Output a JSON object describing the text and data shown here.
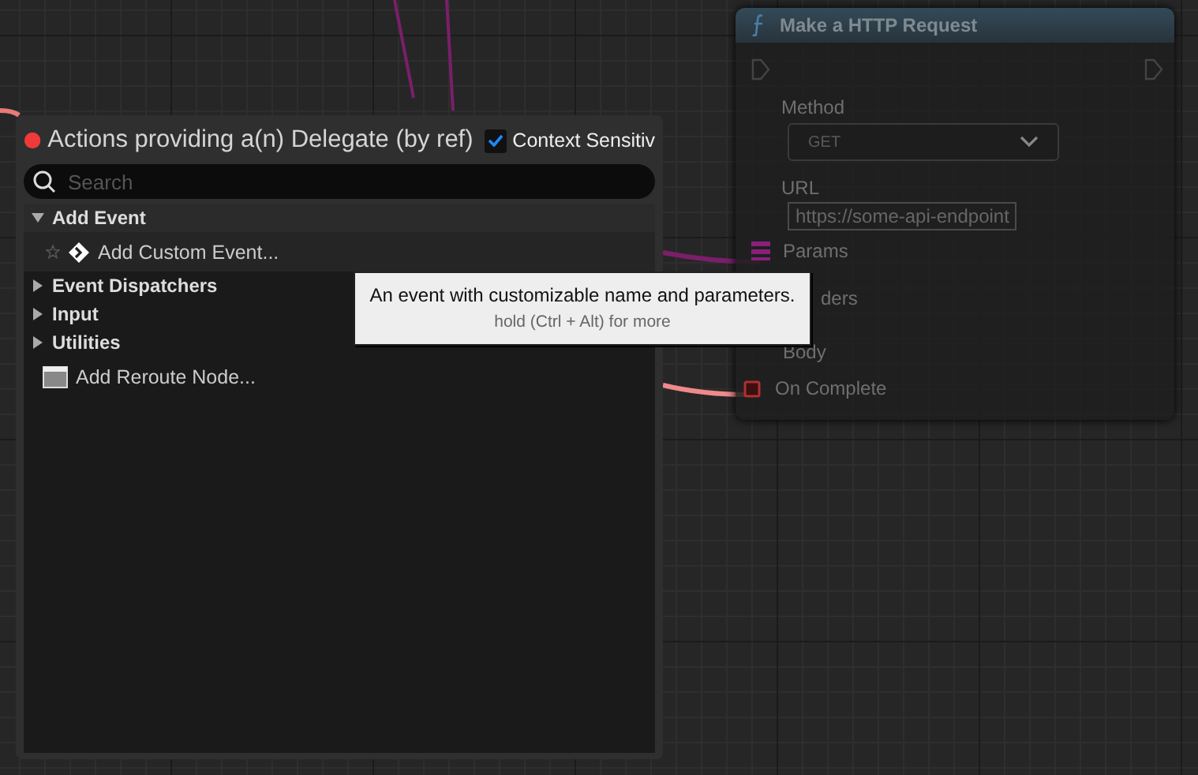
{
  "menu": {
    "title": "Actions providing a(n) Delegate (by ref)",
    "context_sensitive": {
      "label": "Context Sensitiv",
      "checked": true
    },
    "search": {
      "placeholder": "Search"
    },
    "tree": [
      {
        "kind": "category",
        "label": "Add Event",
        "expanded": true,
        "children": [
          {
            "kind": "event",
            "label": "Add Custom Event...",
            "selected": true
          }
        ]
      },
      {
        "kind": "category",
        "label": "Event Dispatchers",
        "expanded": false
      },
      {
        "kind": "category",
        "label": "Input",
        "expanded": false
      },
      {
        "kind": "category",
        "label": "Utilities",
        "expanded": false
      },
      {
        "kind": "reroute",
        "label": "Add Reroute Node...",
        "selected": false
      }
    ]
  },
  "tooltip": {
    "text": "An event with customizable name and parameters.",
    "hint": "hold (Ctrl + Alt) for more"
  },
  "node": {
    "title": "Make a HTTP Request",
    "method": {
      "label": "Method",
      "value": "GET"
    },
    "url": {
      "label": "URL",
      "value": "https://some-api-endpoint"
    },
    "pins": [
      {
        "label": "Params",
        "kind": "struct"
      },
      {
        "label": "ders"
      },
      {
        "label": "Body"
      },
      {
        "label": "On Complete",
        "kind": "delegate"
      }
    ]
  }
}
